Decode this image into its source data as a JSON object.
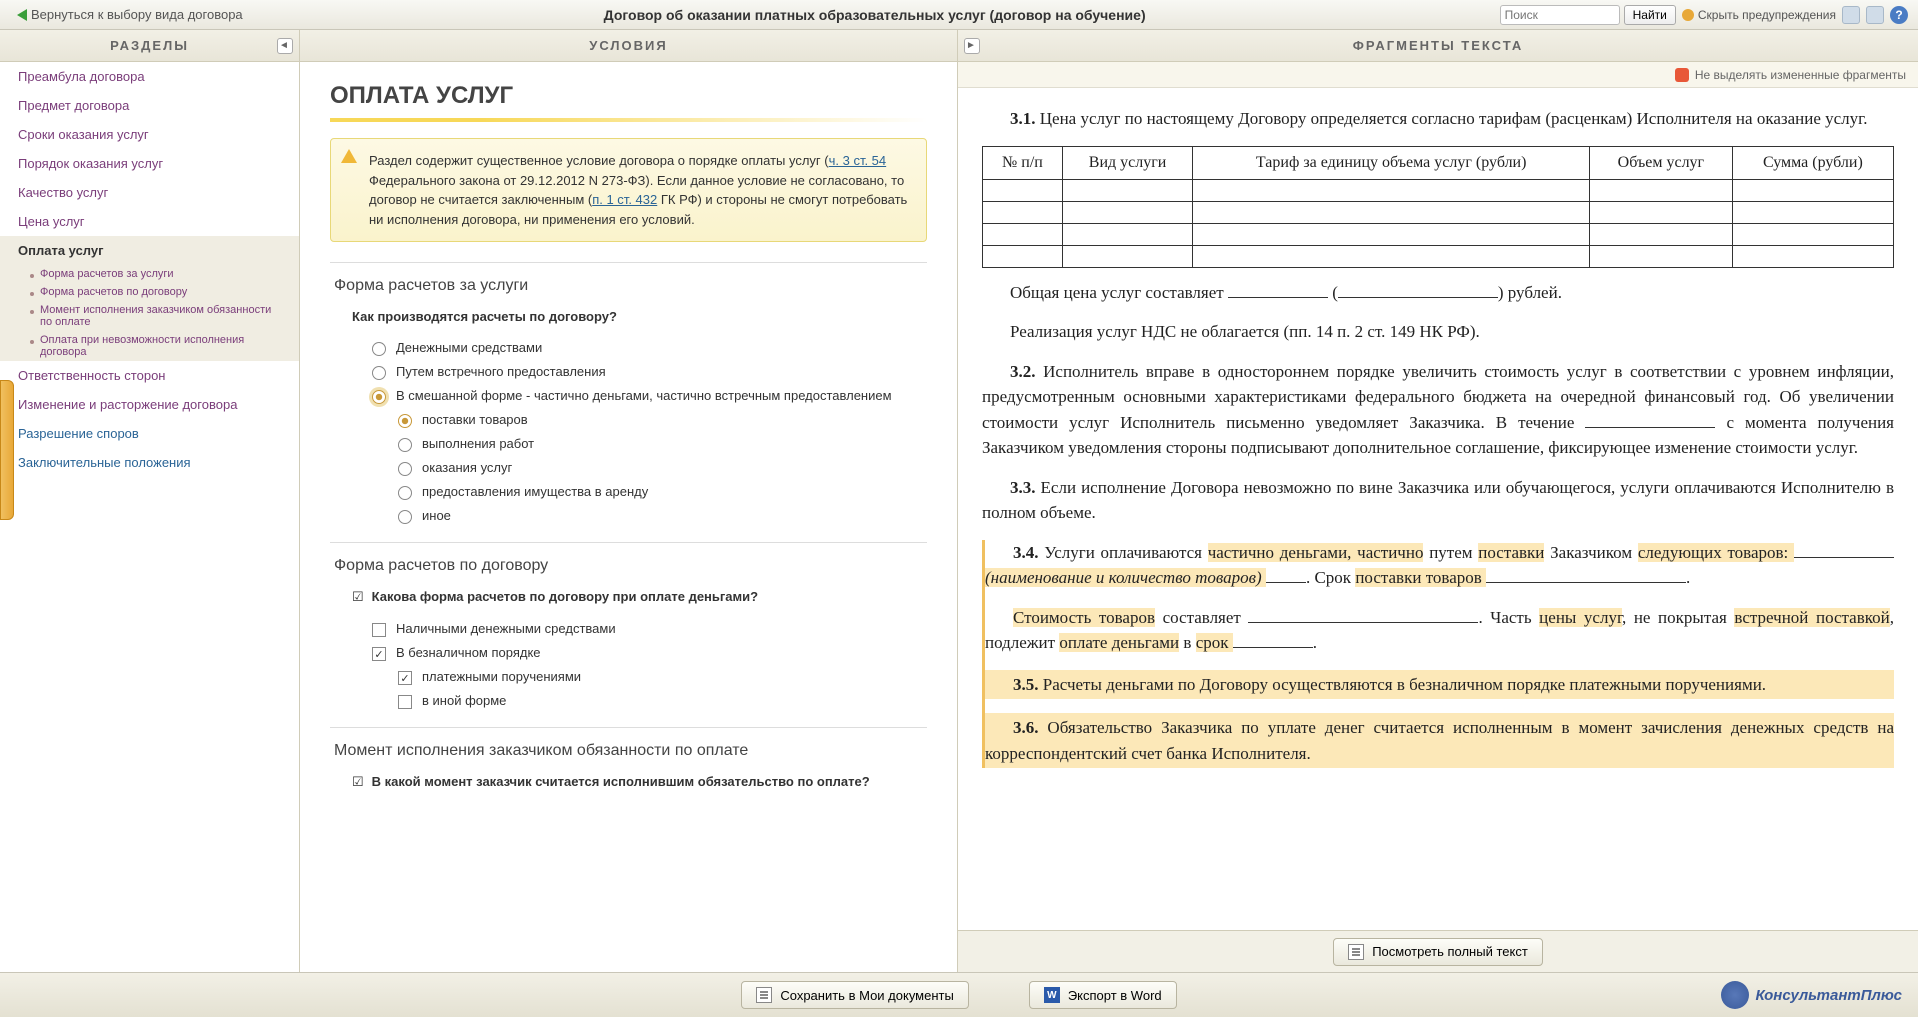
{
  "toolbar": {
    "back": "Вернуться к выбору вида договора",
    "title": "Договор об оказании платных образовательных услуг (договор на обучение)",
    "search_placeholder": "Поиск",
    "find": "Найти",
    "hide_warnings": "Скрыть предупреждения"
  },
  "headers": {
    "sections": "РАЗДЕЛЫ",
    "conditions": "УСЛОВИЯ",
    "fragments": "ФРАГМЕНТЫ ТЕКСТА"
  },
  "nav": {
    "items": [
      "Преамбула договора",
      "Предмет договора",
      "Сроки оказания услуг",
      "Порядок оказания услуг",
      "Качество услуг",
      "Цена услуг"
    ],
    "active": "Оплата услуг",
    "subs": [
      "Форма расчетов за услуги",
      "Форма расчетов по договору",
      "Момент исполнения заказчиком обязанности по оплате",
      "Оплата при невозможности исполнения договора"
    ],
    "after": [
      "Ответственность сторон",
      "Изменение и расторжение договора",
      "Разрешение споров",
      "Заключительные положения"
    ]
  },
  "content": {
    "h1": "ОПЛАТА УСЛУГ",
    "warn_p1": "Раздел содержит существенное условие договора о порядке оплаты услуг (",
    "warn_l1": "ч. 3 ст. 54",
    "warn_p2": " Федерального закона от 29.12.2012 N 273-ФЗ). Если данное условие не согласовано, то договор не считается заключенным (",
    "warn_l2": "п. 1 ст. 432",
    "warn_p3": " ГК РФ) и стороны не смогут потребовать ни исполнения договора, ни применения его условий.",
    "s1_title": "Форма расчетов за услуги",
    "s1_q": "Как производятся расчеты по договору?",
    "s1_opts": [
      "Денежными средствами",
      "Путем встречного предоставления",
      "В смешанной форме - частично деньгами, частично встречным предоставлением"
    ],
    "s1_sub": [
      "поставки товаров",
      "выполнения работ",
      "оказания услуг",
      "предоставления имущества в аренду",
      "иное"
    ],
    "s2_title": "Форма расчетов по договору",
    "s2_q": "Какова форма расчетов по договору при оплате деньгами?",
    "s2_opts": [
      "Наличными денежными средствами",
      "В безналичном порядке"
    ],
    "s2_sub": [
      "платежными поручениями",
      "в иной форме"
    ],
    "s3_title": "Момент исполнения заказчиком обязанности по оплате",
    "s3_q": "В какой момент заказчик считается исполнившим обязательство по оплате?"
  },
  "right": {
    "no_highlight": "Не выделять измененные фрагменты",
    "p31_num": "3.1.",
    "p31": " Цена услуг по настоящему Договору определяется согласно тарифам (расценкам) Исполнителя на оказание услуг.",
    "tbl": {
      "c1": "№ п/п",
      "c2": "Вид услуги",
      "c3": "Тариф за единицу объема услуг (рубли)",
      "c4": "Объем услуг",
      "c5": "Сумма (рубли)"
    },
    "total1": "Общая цена услуг составляет ",
    "total2": " (",
    "total3": ") рублей.",
    "vat": "Реализация услуг НДС не облагается (пп. 14 п. 2 ст. 149 НК РФ).",
    "p32_num": "3.2.",
    "p32": " Исполнитель вправе в одностороннем порядке увеличить стоимость услуг в соответствии с уровнем инфляции, предусмотренным основными характеристиками федерального бюджета на очередной финансовый год. Об увеличении стоимости услуг Исполнитель письменно уведомляет Заказчика. В течение ",
    "p32b": " с момента получения Заказчиком уведомления стороны подписывают дополнительное соглашение, фиксирующее изменение стоимости услуг.",
    "p33_num": "3.3.",
    "p33": " Если исполнение Договора невозможно по вине Заказчика или обучающегося, услуги оплачиваются Исполнителю в полном объеме.",
    "p34_num": "3.4.",
    "p34a": " Услуги оплачиваются ",
    "p34h1": "частично деньгами, частично",
    "p34b": " путем ",
    "p34h2": "поставки",
    "p34c": " Заказчиком ",
    "p34h3": "следующих товаров: ",
    "p34i": "(наименование и количество товаров) ",
    "p34d": ". Срок ",
    "p34h4": "поставки товаров ",
    "p34e": ".",
    "p34s1": "Стоимость ",
    "p34sh1": "товаров",
    "p34s2": " составляет ",
    "p34s3": ". Часть ",
    "p34sh2": "цены услуг",
    "p34s4": ", не покрытая ",
    "p34sh3": "встречной поставкой",
    "p34s5": ", подлежит ",
    "p34sh4": "оплате деньгами",
    "p34s6": " в ",
    "p34sh5": "срок ",
    "p34s7": ".",
    "p35_num": "3.5.",
    "p35": " Расчеты деньгами по Договору осуществляются в безналичном порядке платежными поручениями.",
    "p36_num": "3.6.",
    "p36": " Обязательство Заказчика по уплате денег считается исполненным в момент зачисления денежных средств на корреспондентский счет банка Исполнителя.",
    "view_full": "Посмотреть полный текст"
  },
  "footer": {
    "save": "Сохранить в Мои документы",
    "export": "Экспорт в Word",
    "logo": "КонсультантПлюс"
  }
}
